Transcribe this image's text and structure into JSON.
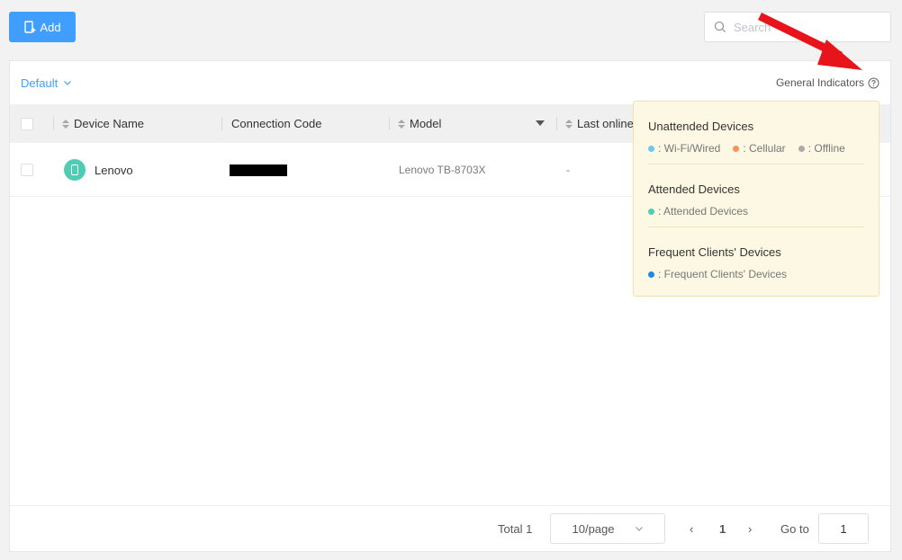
{
  "toolbar": {
    "add_label": "Add",
    "search_placeholder": "Search"
  },
  "view": {
    "selected": "Default",
    "indicators_label": "General Indicators"
  },
  "table": {
    "columns": [
      "Device Name",
      "Connection Code",
      "Model",
      "Last online"
    ],
    "rows": [
      {
        "name": "Lenovo",
        "connection_code": "",
        "model": "Lenovo TB-8703X",
        "last_online": "-"
      }
    ]
  },
  "pagination": {
    "total_label": "Total 1",
    "page_size": "10/page",
    "current_page": "1",
    "goto_label": "Go to",
    "goto_value": "1"
  },
  "popover": {
    "sections": [
      {
        "title": "Unattended Devices",
        "items": [
          {
            "label": ": Wi-Fi/Wired",
            "color": "#6ec6f2"
          },
          {
            "label": ": Cellular",
            "color": "#f5925e"
          },
          {
            "label": ": Offline",
            "color": "#aaaaaa"
          }
        ]
      },
      {
        "title": "Attended Devices",
        "items": [
          {
            "label": ": Attended Devices",
            "color": "#4ecdb4"
          }
        ]
      },
      {
        "title": "Frequent Clients' Devices",
        "items": [
          {
            "label": ": Frequent Clients' Devices",
            "color": "#1e88e5"
          }
        ]
      }
    ]
  },
  "colors": {
    "accent": "#409eff",
    "annotation_arrow": "#e8141c"
  }
}
